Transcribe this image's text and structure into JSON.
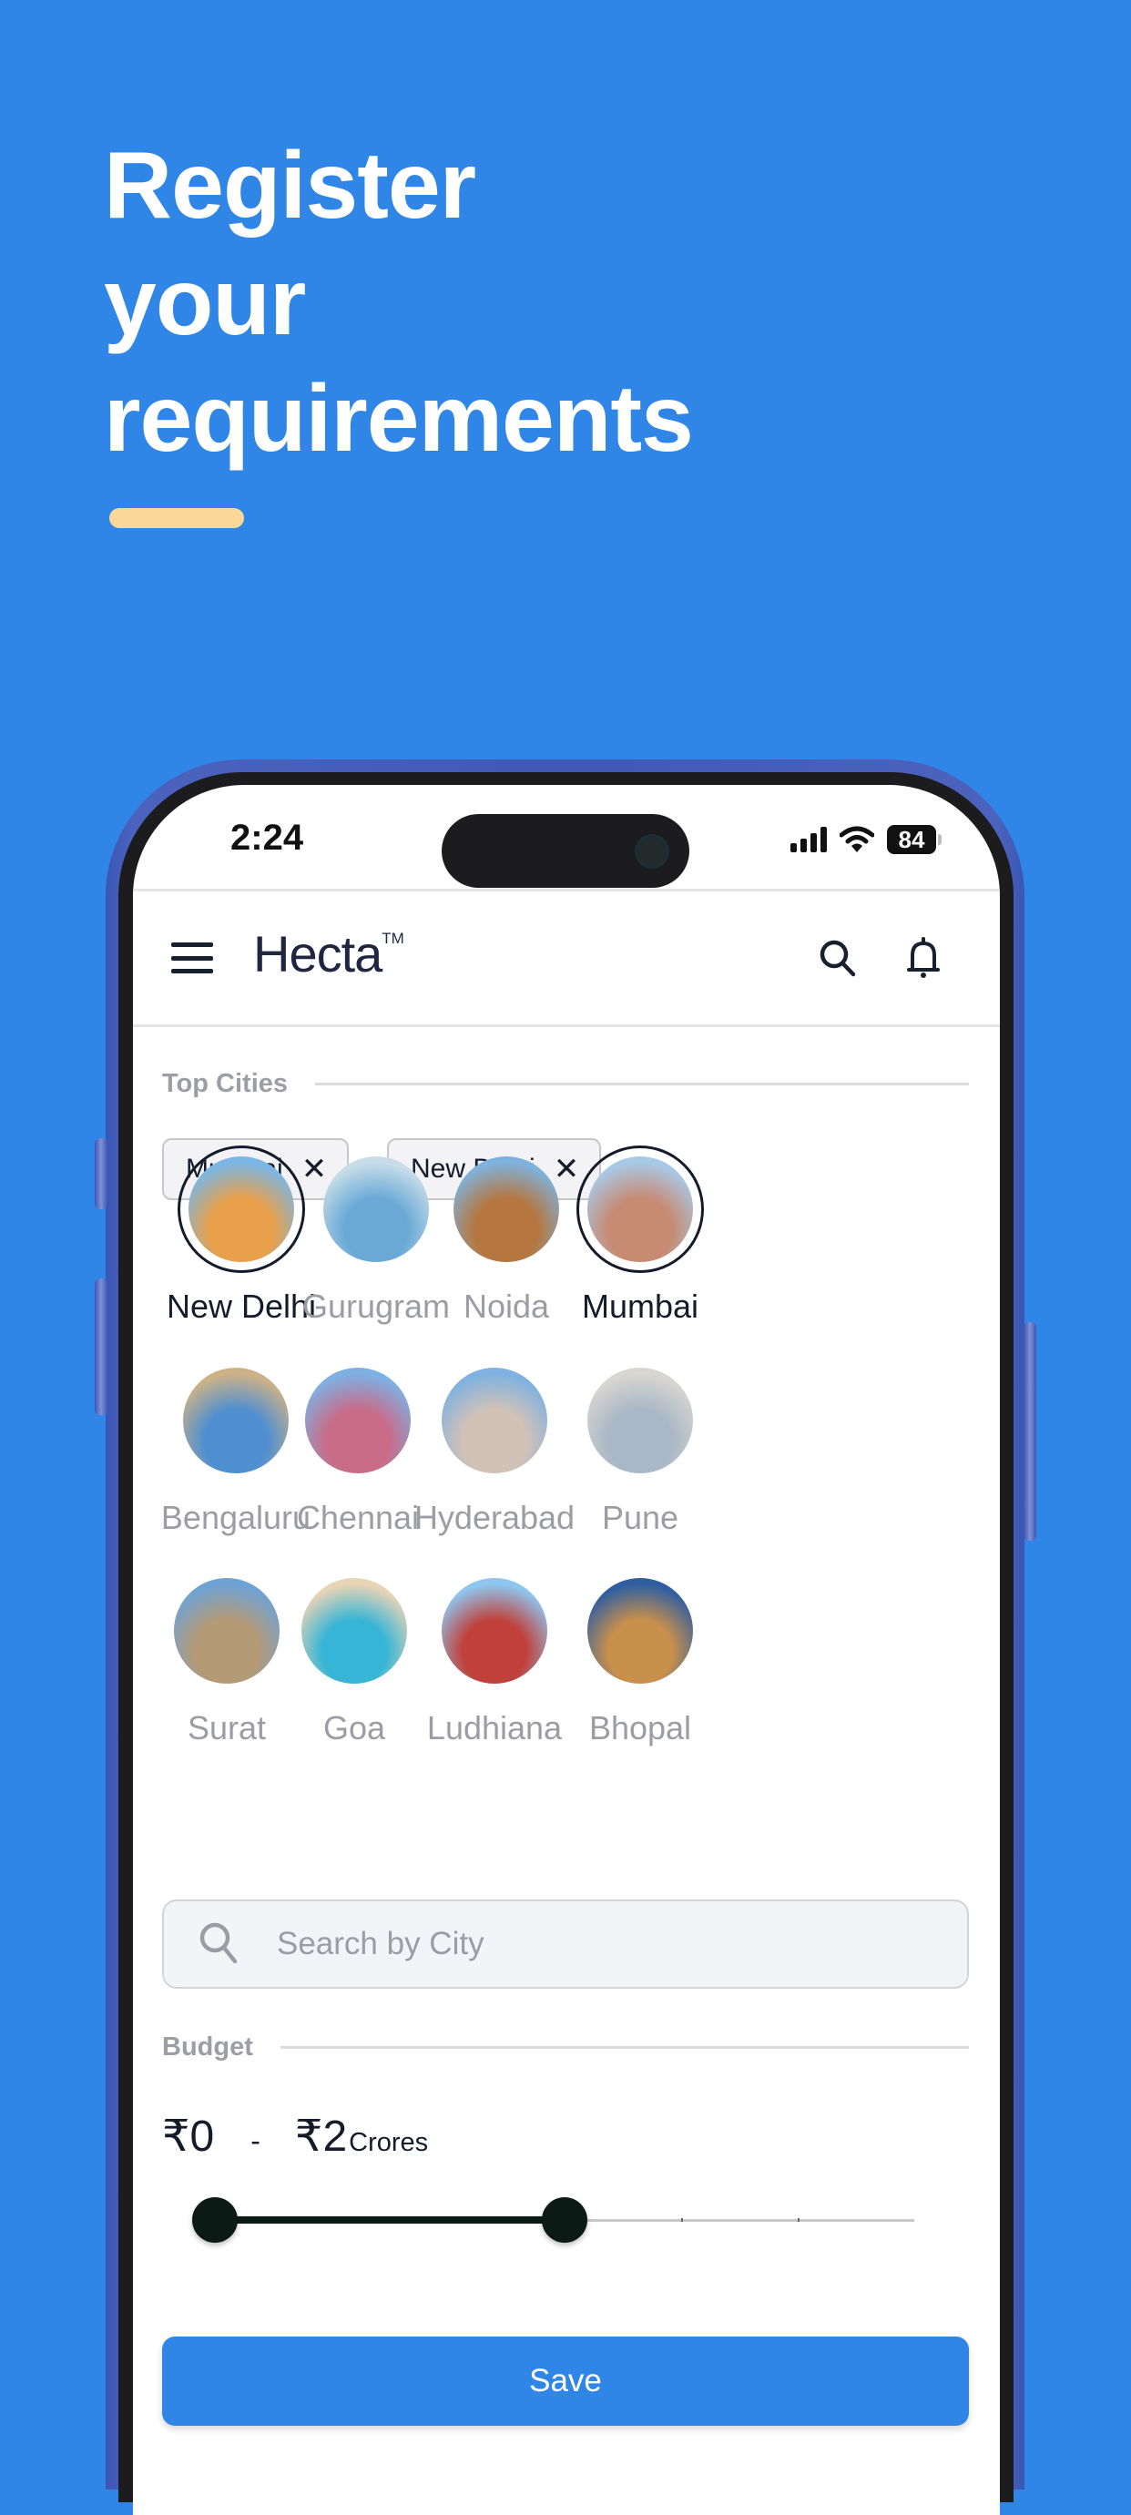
{
  "promo": {
    "headline_lines": [
      "Register",
      "your",
      "requirements"
    ],
    "accent_color": "#fbd89a",
    "background_color": "#2f86e6"
  },
  "status_bar": {
    "time": "2:24",
    "battery_percent": "84",
    "icons": [
      "signal-icon",
      "wifi-icon",
      "battery-icon"
    ]
  },
  "header": {
    "logo": "Hecta",
    "logo_mark": "TM",
    "icons": [
      "menu-icon",
      "search-icon",
      "bell-icon"
    ]
  },
  "top_cities": {
    "label": "Top Cities",
    "selected_chips": [
      {
        "label": "Mumbai",
        "remove_icon": "close-icon"
      },
      {
        "label": "New Delhi",
        "remove_icon": "close-icon"
      }
    ],
    "cities": [
      {
        "name": "New Delhi",
        "selected": true
      },
      {
        "name": "Gurugram",
        "selected": false
      },
      {
        "name": "Noida",
        "selected": false
      },
      {
        "name": "Mumbai",
        "selected": true
      },
      {
        "name": "Bengaluru",
        "selected": false
      },
      {
        "name": "Chennai",
        "selected": false
      },
      {
        "name": "Hyderabad",
        "selected": false
      },
      {
        "name": "Pune",
        "selected": false
      },
      {
        "name": "Surat",
        "selected": false
      },
      {
        "name": "Goa",
        "selected": false
      },
      {
        "name": "Ludhiana",
        "selected": false
      },
      {
        "name": "Bhopal",
        "selected": false
      }
    ],
    "search_placeholder": "Search by City",
    "search_value": ""
  },
  "budget": {
    "label": "Budget",
    "currency": "₹",
    "min_value": "0",
    "separator": "-",
    "max_value": "2",
    "unit": "Crores",
    "slider": {
      "steps": 6,
      "min_fraction": 0,
      "max_fraction": 0.5
    }
  },
  "actions": {
    "save_label": "Save"
  }
}
